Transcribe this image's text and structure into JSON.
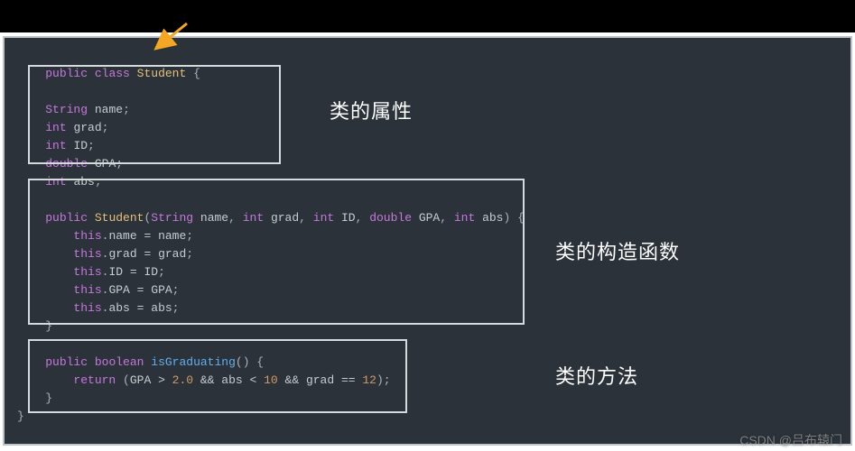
{
  "code": {
    "line1_kw1": "public",
    "line1_kw2": "class",
    "line1_cls": "Student",
    "line1_end": "{",
    "field1_type": "String",
    "field1_name": "name",
    "field2_type": "int",
    "field2_name": "grad",
    "field3_type": "int",
    "field3_name": "ID",
    "field4_type": "double",
    "field4_name": "GPA",
    "field5_type": "int",
    "field5_name": "abs",
    "semi": ";",
    "ctor_kw1": "public",
    "ctor_name": "Student",
    "ctor_p1t": "String",
    "ctor_p1n": "name",
    "ctor_p2t": "int",
    "ctor_p2n": "grad",
    "ctor_p3t": "int",
    "ctor_p3n": "ID",
    "ctor_p4t": "double",
    "ctor_p4n": "GPA",
    "ctor_p5t": "int",
    "ctor_p5n": "abs",
    "ctor_sig_end": ") {",
    "this": "this",
    "dot": ".",
    "eq": " = ",
    "ctor_a1_lhs": "name",
    "ctor_a1_rhs": "name",
    "ctor_a2_lhs": "grad",
    "ctor_a2_rhs": "grad",
    "ctor_a3_lhs": "ID",
    "ctor_a3_rhs": "ID",
    "ctor_a4_lhs": "GPA",
    "ctor_a4_rhs": "GPA",
    "ctor_a5_lhs": "abs",
    "ctor_a5_rhs": "abs",
    "close_brace": "}",
    "m_kw1": "public",
    "m_ret": "boolean",
    "m_name": "isGraduating",
    "m_sig_end": "() {",
    "ret_kw": "return",
    "ret_expr_gpa": "GPA",
    "ret_gt": " > ",
    "ret_v1": "2.0",
    "ret_and": " && ",
    "ret_abs": "abs",
    "ret_lt": " < ",
    "ret_v2": "10",
    "ret_grad": "grad",
    "ret_eqeq": " == ",
    "ret_v3": "12",
    "lparen": "(",
    "rparen": ")",
    "comma": ", "
  },
  "labels": {
    "fields": "类的属性",
    "constructor": "类的构造函数",
    "method": "类的方法"
  },
  "watermark": "CSDN @吕布辕门"
}
